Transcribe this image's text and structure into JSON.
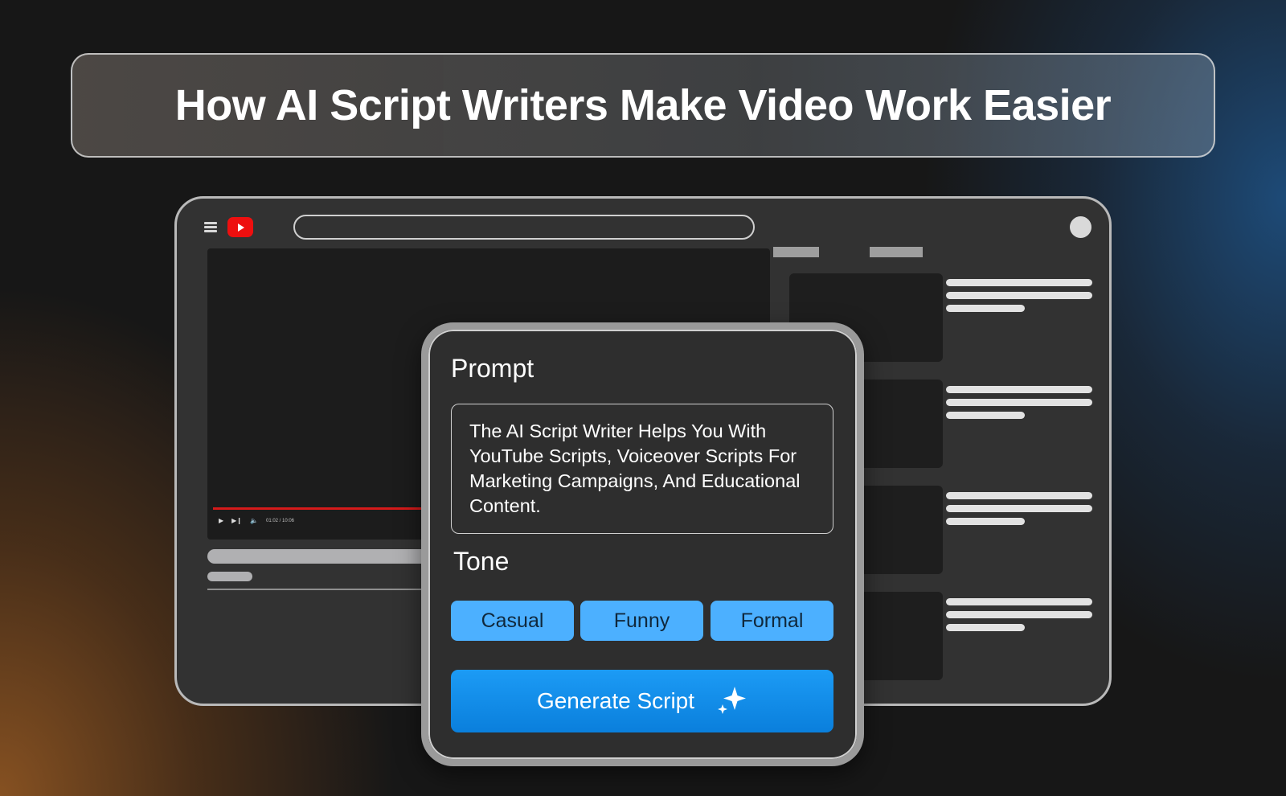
{
  "header": {
    "title": "How AI Script Writers Make Video Work Easier"
  },
  "player": {
    "time": "01:02 / 10:06"
  },
  "prompt_card": {
    "prompt_label": "Prompt",
    "prompt_text": "The AI Script Writer Helps You With YouTube Scripts, Voiceover Scripts For Marketing Campaigns, And Educational Content.",
    "tone_label": "Tone",
    "tones": [
      "Casual",
      "Funny",
      "Formal"
    ],
    "generate_label": "Generate Script"
  },
  "colors": {
    "tone_button": "#4cb0ff",
    "generate_button": "#1c9bf5",
    "youtube_red": "#ee0f0f"
  },
  "icons": [
    "menu-icon",
    "youtube-logo-icon",
    "play-icon",
    "next-icon",
    "volume-icon",
    "sparkle-icon"
  ]
}
